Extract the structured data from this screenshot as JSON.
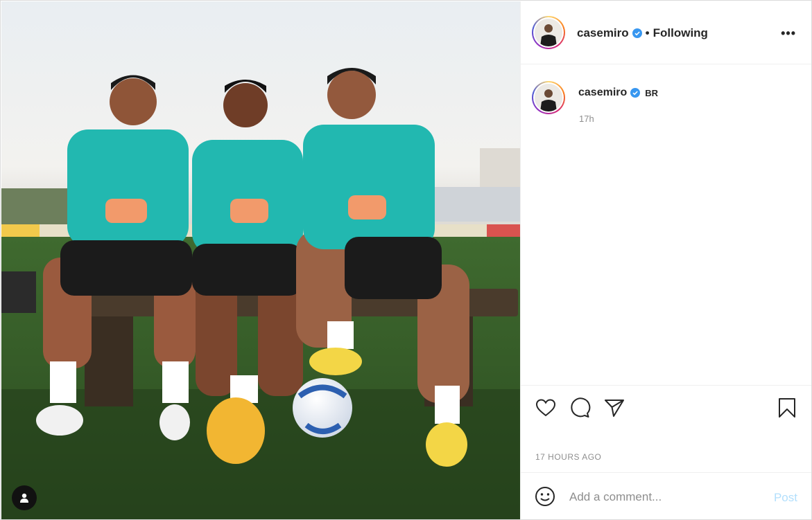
{
  "post": {
    "username": "casemiro",
    "verified": true,
    "follow_status": "Following",
    "separator": "•",
    "more_label": "•••"
  },
  "caption": {
    "username": "casemiro",
    "text": "BR",
    "time": "17h"
  },
  "actions": {
    "icons": [
      "heart-icon",
      "comment-icon",
      "share-icon",
      "bookmark-icon"
    ],
    "timestamp": "17 HOURS AGO"
  },
  "comment": {
    "placeholder": "Add a comment...",
    "post_label": "Post",
    "emoji_icon": "smiley-icon"
  },
  "photo": {
    "tag_icon": "user-tag-icon",
    "jersey_color": "#22b8b0"
  },
  "colors": {
    "verified_blue": "#3897f0",
    "post_disabled": "#b2dffc"
  }
}
